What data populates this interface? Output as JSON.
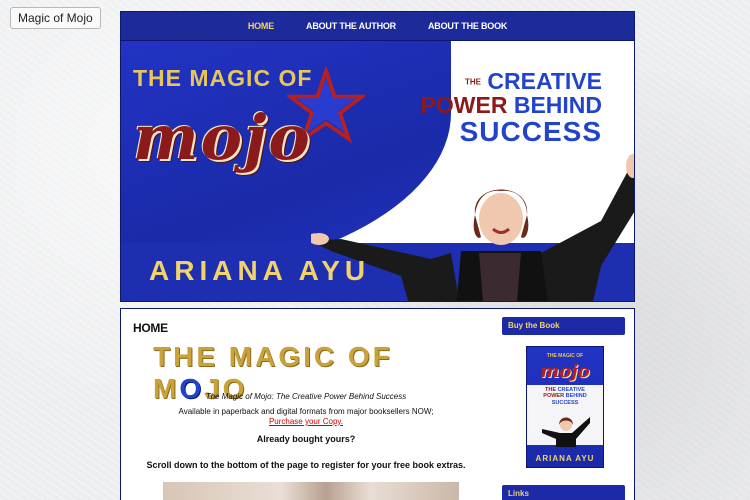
{
  "window": {
    "tab_title": "Magic of Mojo"
  },
  "nav": {
    "items": [
      {
        "label": "HOME",
        "active": true
      },
      {
        "label": "ABOUT THE AUTHOR",
        "active": false
      },
      {
        "label": "ABOUT THE BOOK",
        "active": false
      }
    ]
  },
  "banner": {
    "title_prefix": "THE MAGIC OF",
    "title_script": "mojo",
    "tagline": {
      "the": "THE",
      "creative": "CREATIVE",
      "power": "POWER",
      "behind": "BEHIND",
      "success": "SUCCESS"
    },
    "author": "ARIANA AYU"
  },
  "main": {
    "heading": "HOME",
    "book_title_left": "THE MAGIC OF M",
    "book_title_star_letter": "O",
    "book_title_right": "JO",
    "subtitle": "The Magic of Mojo: The Creative Power Behind Success",
    "availability": "Available in paperback and digital formats from major booksellers NOW;",
    "purchase_link": "Purchase your Copy.",
    "already_bought": "Already bought yours?",
    "scroll_note": "Scroll down to the bottom of the page to register for your free book extras."
  },
  "sidebar": {
    "buy_heading": "Buy the Book",
    "links_heading": "Links",
    "cover": {
      "top": "THE MAGIC OF",
      "script": "mojo",
      "line1_the": "THE",
      "line1": "CREATIVE",
      "line2_power": "POWER",
      "line2": "BEHIND",
      "line3": "SUCCESS",
      "name": "ARIANA AYU"
    }
  },
  "colors": {
    "nav_blue": "#1d2a9a",
    "accent_gold": "#f2d36b",
    "brand_red": "#8b1a1a",
    "brand_blue": "#2244cc",
    "link_red": "#cc0000"
  }
}
